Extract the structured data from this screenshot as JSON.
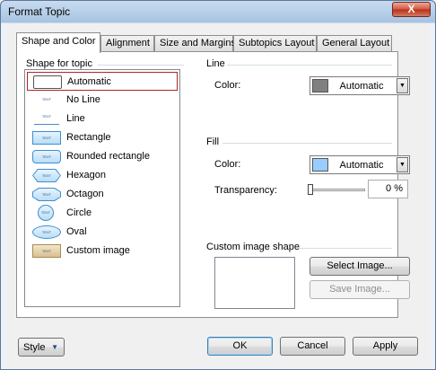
{
  "window": {
    "title": "Format Topic",
    "close_label": "X"
  },
  "tabs": [
    {
      "label": "Shape and Color",
      "active": true
    },
    {
      "label": "Alignment",
      "active": false
    },
    {
      "label": "Size and Margins",
      "active": false
    },
    {
      "label": "Subtopics Layout",
      "active": false
    },
    {
      "label": "General Layout",
      "active": false
    }
  ],
  "shape_section": {
    "title": "Shape for topic",
    "selected": "Automatic",
    "thumb_text": "TEXT",
    "items": [
      {
        "label": "Automatic",
        "icon": "automatic-shape-icon"
      },
      {
        "label": "No Line",
        "icon": "no-line-shape-icon"
      },
      {
        "label": "Line",
        "icon": "line-shape-icon"
      },
      {
        "label": "Rectangle",
        "icon": "rectangle-shape-icon"
      },
      {
        "label": "Rounded rectangle",
        "icon": "rounded-rectangle-shape-icon"
      },
      {
        "label": "Hexagon",
        "icon": "hexagon-shape-icon"
      },
      {
        "label": "Octagon",
        "icon": "octagon-shape-icon"
      },
      {
        "label": "Circle",
        "icon": "circle-shape-icon"
      },
      {
        "label": "Oval",
        "icon": "oval-shape-icon"
      },
      {
        "label": "Custom image",
        "icon": "custom-image-shape-icon"
      }
    ]
  },
  "line_section": {
    "title": "Line",
    "color_label": "Color:",
    "color_value": "Automatic",
    "swatch_color": "#808080"
  },
  "fill_section": {
    "title": "Fill",
    "color_label": "Color:",
    "color_value": "Automatic",
    "swatch_color": "#99ccff",
    "transparency_label": "Transparency:",
    "transparency_value": "0 %",
    "transparency_level": 0
  },
  "custom_image_section": {
    "title": "Custom image shape",
    "select_button": "Select Image...",
    "save_button": "Save Image..."
  },
  "footer": {
    "style_button": "Style",
    "ok_button": "OK",
    "cancel_button": "Cancel",
    "apply_button": "Apply"
  }
}
